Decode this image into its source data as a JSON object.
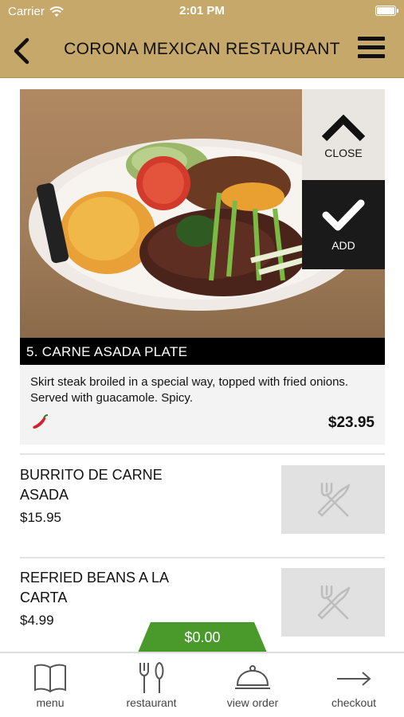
{
  "status_bar": {
    "carrier": "Carrier",
    "time": "2:01 PM"
  },
  "header": {
    "title": "CORONA MEXICAN RESTAURANT",
    "back_icon": "chevron-left-icon",
    "menu_icon": "hamburger-icon"
  },
  "featured": {
    "name": "5. CARNE ASADA PLATE",
    "description": "Skirt steak broiled in a special way, topped with fried onions. Served with guacamole. Spicy.",
    "price": "$23.95",
    "close_label": "CLOSE",
    "add_label": "ADD",
    "spicy_icon": "chili-pepper-icon"
  },
  "items": [
    {
      "name": "BURRITO DE CARNE ASADA",
      "price": "$15.95",
      "icon": "utensils-icon"
    },
    {
      "name": "REFRIED BEANS A LA CARTA",
      "price": "$4.99",
      "icon": "utensils-icon"
    }
  ],
  "cart": {
    "total": "$0.00"
  },
  "tabs": [
    {
      "label": "menu",
      "icon": "book-icon"
    },
    {
      "label": "restaurant",
      "icon": "fork-knife-icon"
    },
    {
      "label": "view order",
      "icon": "cloche-icon"
    },
    {
      "label": "checkout",
      "icon": "arrow-right-icon"
    }
  ],
  "colors": {
    "header_bg": "#c6a96a",
    "cart_green": "#4a9a2b",
    "caption_bg": "#000000"
  }
}
